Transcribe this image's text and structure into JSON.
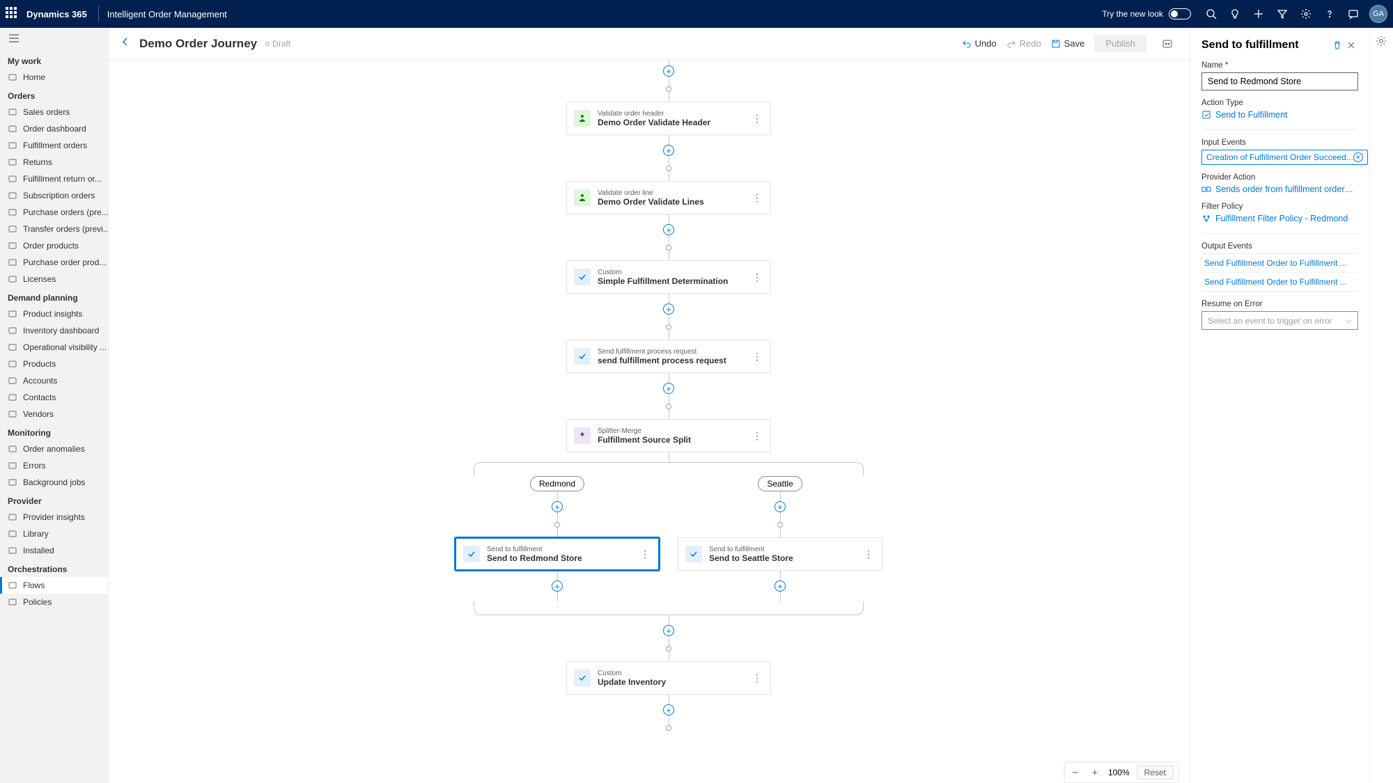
{
  "topbar": {
    "brand": "Dynamics 365",
    "app": "Intelligent Order Management",
    "try_new": "Try the new look",
    "avatar": "GA"
  },
  "nav": {
    "groups": [
      {
        "label": "My work",
        "items": [
          {
            "label": "Home"
          }
        ]
      },
      {
        "label": "Orders",
        "items": [
          {
            "label": "Sales orders"
          },
          {
            "label": "Order dashboard"
          },
          {
            "label": "Fulfillment orders"
          },
          {
            "label": "Returns"
          },
          {
            "label": "Fulfillment return or..."
          },
          {
            "label": "Subscription orders"
          },
          {
            "label": "Purchase orders (pre..."
          },
          {
            "label": "Transfer orders (previ..."
          },
          {
            "label": "Order products"
          },
          {
            "label": "Purchase order prod..."
          },
          {
            "label": "Licenses"
          }
        ]
      },
      {
        "label": "Demand planning",
        "items": [
          {
            "label": "Product insights"
          },
          {
            "label": "Inventory dashboard"
          },
          {
            "label": "Operational visibility ..."
          },
          {
            "label": "Products"
          },
          {
            "label": "Accounts"
          },
          {
            "label": "Contacts"
          },
          {
            "label": "Vendors"
          }
        ]
      },
      {
        "label": "Monitoring",
        "items": [
          {
            "label": "Order anomalies"
          },
          {
            "label": "Errors"
          },
          {
            "label": "Background jobs"
          }
        ]
      },
      {
        "label": "Provider",
        "items": [
          {
            "label": "Provider insights"
          },
          {
            "label": "Library"
          },
          {
            "label": "Installed"
          }
        ]
      },
      {
        "label": "Orchestrations",
        "items": [
          {
            "label": "Flows",
            "active": true
          },
          {
            "label": "Policies"
          }
        ]
      }
    ]
  },
  "page": {
    "title": "Demo Order Journey",
    "status": "Draft",
    "undo": "Undo",
    "redo": "Redo",
    "save": "Save",
    "publish": "Publish"
  },
  "flow": {
    "nodes": [
      {
        "type": "Validate order header",
        "name": "Demo Order Validate Header",
        "icon": "green"
      },
      {
        "type": "Validate order line",
        "name": "Demo Order Validate Lines",
        "icon": "green"
      },
      {
        "type": "Custom",
        "name": "Simple Fulfillment Determination",
        "icon": "blue"
      },
      {
        "type": "Send fulfillment process request",
        "name": "send fulfillment process request",
        "icon": "blue"
      },
      {
        "type": "Splitter-Merge",
        "name": "Fulfillment Source Split",
        "icon": "purple"
      }
    ],
    "branches": {
      "left": {
        "pill": "Redmond",
        "node": {
          "type": "Send to fulfillment",
          "name": "Send to Redmond Store",
          "icon": "blue",
          "selected": true
        }
      },
      "right": {
        "pill": "Seattle",
        "node": {
          "type": "Send to fulfillment",
          "name": "Send to Seattle Store",
          "icon": "blue"
        }
      }
    },
    "after_branch": {
      "type": "Custom",
      "name": "Update Inventory",
      "icon": "blue"
    }
  },
  "zoom": {
    "pct": "100%",
    "reset": "Reset"
  },
  "panel": {
    "title": "Send to fulfillment",
    "name_label": "Name",
    "name_value": "Send to Redmond Store",
    "action_type_label": "Action Type",
    "action_type_value": "Send to Fulfillment",
    "input_events_label": "Input Events",
    "input_event_chip": "Creation of Fulfillment Order Succeed...",
    "provider_action_label": "Provider Action",
    "provider_action_value": "Sends order from fulfillment order to de...",
    "filter_policy_label": "Filter Policy",
    "filter_policy_value": "Fulfillment Filter Policy - Redmond",
    "output_events_label": "Output Events",
    "output_events": [
      "Send Fulfillment Order to Fulfillment ...",
      "Send Fulfillment Order to Fulfillment ..."
    ],
    "resume_label": "Resume on Error",
    "resume_placeholder": "Select an event to trigger on error"
  }
}
